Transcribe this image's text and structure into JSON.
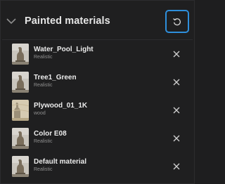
{
  "panel": {
    "title": "Painted materials",
    "accent_color": "#2e8fdc",
    "icons": {
      "collapse": "chevron-down-icon",
      "reset": "reset-icon",
      "remove": "close-icon"
    }
  },
  "materials": [
    {
      "name": "Water_Pool_Light",
      "type": "Realistic",
      "thumbnail": "stone-statue"
    },
    {
      "name": "Tree1_Green",
      "type": "Realistic",
      "thumbnail": "stone-statue"
    },
    {
      "name": "Plywood_01_1K",
      "type": "wood",
      "thumbnail": "wood-texture"
    },
    {
      "name": "Color E08",
      "type": "Realistic",
      "thumbnail": "stone-statue"
    },
    {
      "name": "Default material",
      "type": "Realistic",
      "thumbnail": "stone-statue"
    }
  ]
}
